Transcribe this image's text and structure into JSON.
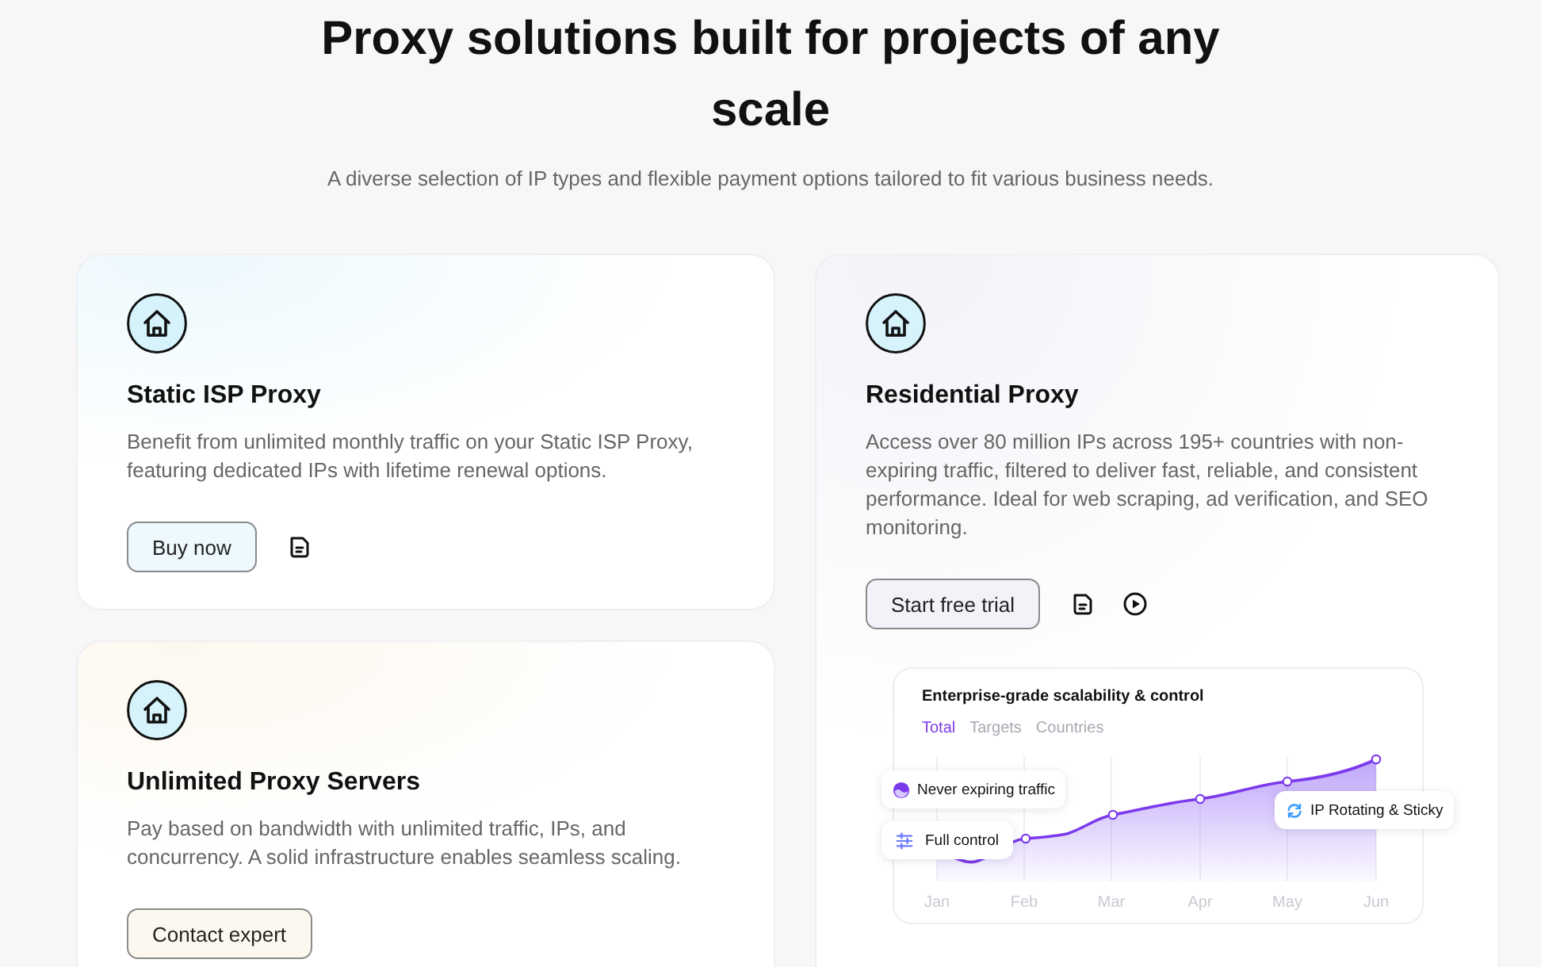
{
  "header": {
    "title": "Proxy solutions built for projects of any scale",
    "subtitle": "A diverse selection of IP types and flexible payment options tailored to fit various business needs."
  },
  "columns": [
    {
      "cards": [
        {
          "title": "Static ISP Proxy",
          "description": "Benefit from unlimited monthly traffic on your Static ISP Proxy, featuring dedicated IPs with lifetime renewal options.",
          "button": "Buy now",
          "color": "#edf9fd",
          "links": [
            {
              "kind": "docs"
            }
          ]
        },
        {
          "title": "Unlimited Proxy Servers",
          "description": "Pay based on bandwidth with unlimited traffic, IPs, and concurrency. A solid infrastructure enables seamless scaling.",
          "button": "Contact expert",
          "color": "#fdf8ef"
        }
      ]
    },
    {
      "cards": [
        {
          "title": "Residential Proxy",
          "description": "Access over 80 million IPs across 195+ countries with non-expiring traffic, filtered to deliver fast, reliable, and consistent performance. Ideal for web scraping, ad verification, and SEO monitoring.",
          "button": "Start free trial",
          "color": "#f3f2f8",
          "links": [
            {
              "kind": "docs"
            },
            {
              "kind": "video"
            }
          ],
          "chart": {
            "title": "Enterprise-grade scalability & control",
            "tabs": [
              {
                "label": "Total",
                "selected": true
              },
              {
                "label": "Targets",
                "selected": false
              },
              {
                "label": "Countries",
                "selected": false
              }
            ],
            "months": [
              "Jan",
              "Feb",
              "Mar",
              "Apr",
              "May",
              "Jun"
            ],
            "callouts": [
              {
                "label": "Never expiring traffic",
                "kind": "traffic"
              },
              {
                "label": "Full control",
                "kind": "control"
              },
              {
                "label": "IP Rotating & Sticky",
                "kind": "rotation"
              }
            ]
          }
        }
      ]
    }
  ]
}
